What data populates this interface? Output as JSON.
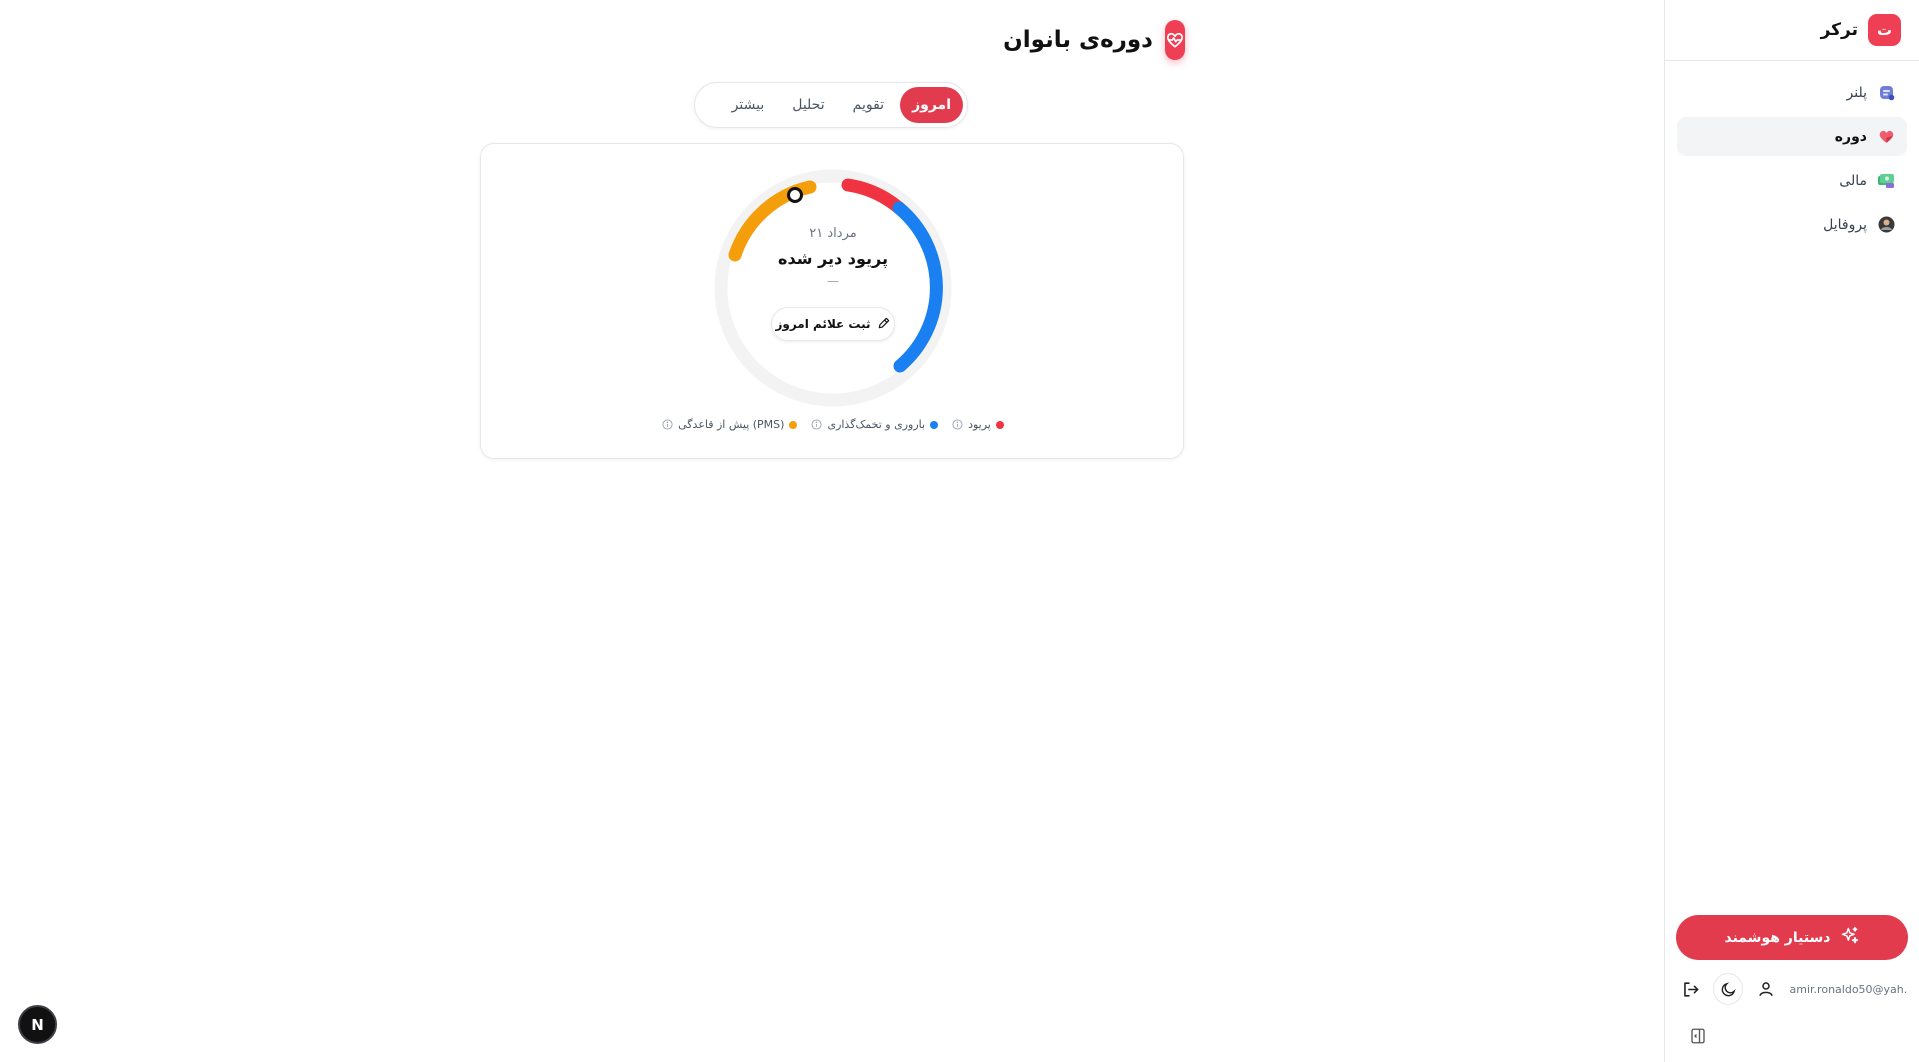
{
  "sidebar": {
    "brand": {
      "logo_letter": "ت",
      "name": "ترکر"
    },
    "items": [
      {
        "label": "پلنر",
        "icon": "planner-icon",
        "active": false
      },
      {
        "label": "دوره",
        "icon": "heart-icon",
        "active": true
      },
      {
        "label": "مالی",
        "icon": "money-icon",
        "active": false
      },
      {
        "label": "پروفایل",
        "icon": "profile-icon",
        "active": false
      }
    ],
    "assistant_label": "دستیار هوشمند",
    "user_email": "amir.ronaldo50@yah..."
  },
  "header": {
    "title": "دوره‌ی بانوان",
    "icon": "heart-pulse-icon"
  },
  "tabs": [
    {
      "label": "امروز",
      "active": true
    },
    {
      "label": "تقویم",
      "active": false
    },
    {
      "label": "تحلیل",
      "active": false
    },
    {
      "label": "بیشتر",
      "active": false
    }
  ],
  "today_card": {
    "date": "۲۱ مرداد",
    "status": "پریود دیر شده",
    "sub": "—",
    "log_button_label": "ثبت علائم امروز",
    "legend": [
      {
        "label": "پریود",
        "color": "#ef3340"
      },
      {
        "label": "باروری و تخمک‌گذاری",
        "color": "#1a7ff0"
      },
      {
        "label": "پیش از قاعدگی (PMS)",
        "color": "#f59e0b"
      }
    ]
  },
  "colors": {
    "accent": "#e23b4d",
    "period": "#ef3340",
    "fertile": "#1a7ff0",
    "pms": "#f59e0b",
    "track": "#f3f3f3"
  },
  "dev_badge": {
    "letter": "N"
  }
}
